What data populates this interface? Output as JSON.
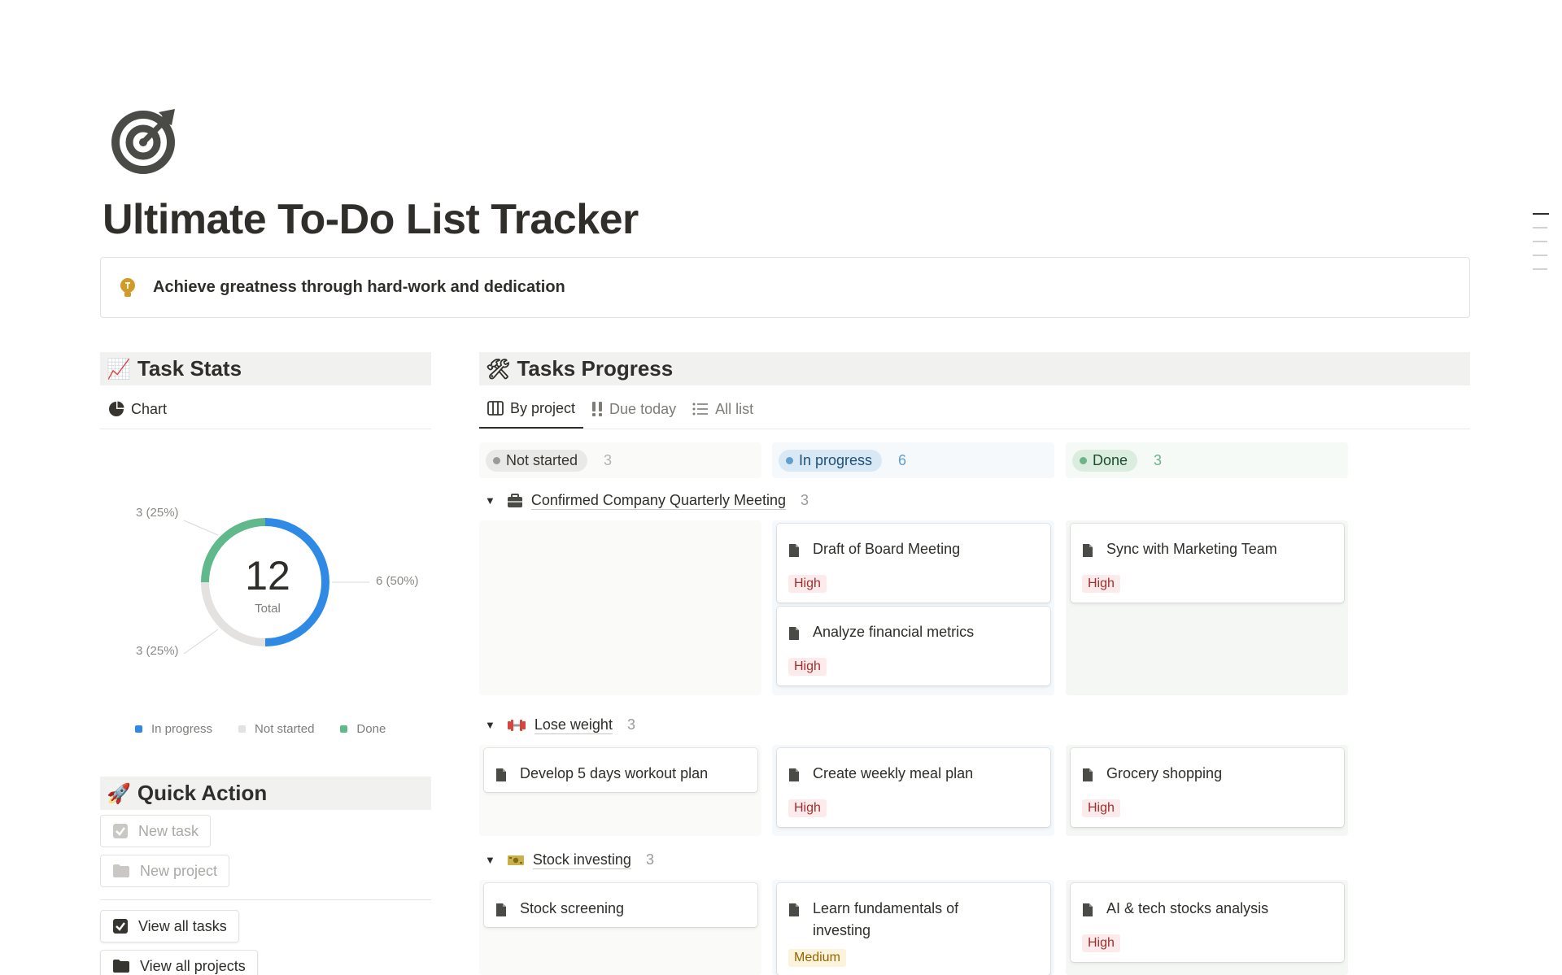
{
  "page": {
    "title": "Ultimate To-Do List Tracker",
    "icon": "target-icon",
    "callout": {
      "icon": "lightbulb-icon",
      "text": "Achieve greatness through hard-work and dedication"
    }
  },
  "task_stats": {
    "heading_emoji": "📈",
    "heading": "Task Stats",
    "view_tab": "Chart",
    "chart": {
      "total_value": "12",
      "total_label": "Total",
      "labels": {
        "in_progress": "6 (50%)",
        "done": "3 (25%)",
        "not_started": "3 (25%)"
      }
    },
    "legend": [
      "In progress",
      "Not started",
      "Done"
    ]
  },
  "chart_data": {
    "type": "pie",
    "variant": "donut",
    "categories": [
      "In progress",
      "Not started",
      "Done"
    ],
    "values": [
      6,
      3,
      3
    ],
    "percentages": [
      50,
      25,
      25
    ],
    "colors": [
      "#2f8ae6",
      "#e3e2e0",
      "#5fb98a"
    ],
    "center_text": "12",
    "center_subtext": "Total",
    "legend_position": "bottom"
  },
  "quick_action": {
    "heading_emoji": "🚀",
    "heading": "Quick Action",
    "buttons": [
      {
        "label": "New task",
        "icon": "checkbox-icon"
      },
      {
        "label": "New project",
        "icon": "folder-icon"
      },
      {
        "label": "View all tasks",
        "icon": "checkbox-icon"
      },
      {
        "label": "View all projects",
        "icon": "folder-icon"
      }
    ]
  },
  "tasks_progress": {
    "heading_emoji": "🛠",
    "heading": "Tasks Progress",
    "tabs": [
      {
        "label": "By project",
        "icon": "board-icon",
        "active": true
      },
      {
        "label": "Due today",
        "icon": "double-exclamation-icon",
        "active": false
      },
      {
        "label": "All list",
        "icon": "list-icon",
        "active": false
      }
    ],
    "columns": [
      {
        "label": "Not started",
        "count": "3",
        "color": "#9b9a97"
      },
      {
        "label": "In progress",
        "count": "6",
        "color": "#5e9fd0"
      },
      {
        "label": "Done",
        "count": "3",
        "color": "#6cb48a"
      }
    ],
    "groups": [
      {
        "name": "Confirmed Company Quarterly Meeting",
        "count": "3",
        "icon": "briefcase-icon",
        "cards": {
          "in_progress": [
            {
              "title": "Draft of Board Meeting",
              "priority": "High"
            },
            {
              "title": "Analyze financial metrics",
              "priority": "High"
            }
          ],
          "done": [
            {
              "title": "Sync with Marketing Team",
              "priority": "High"
            }
          ]
        }
      },
      {
        "name": "Lose weight",
        "count": "3",
        "icon": "dumbbell-icon",
        "cards": {
          "not_started": [
            {
              "title": "Develop 5 days workout plan"
            }
          ],
          "in_progress": [
            {
              "title": "Create weekly meal plan",
              "priority": "High"
            }
          ],
          "done": [
            {
              "title": "Grocery shopping",
              "priority": "High"
            }
          ]
        }
      },
      {
        "name": "Stock investing",
        "count": "3",
        "icon": "money-icon",
        "cards": {
          "not_started": [
            {
              "title": "Stock screening"
            }
          ],
          "in_progress": [
            {
              "title": "Learn fundamentals of investing",
              "priority": "Medium"
            }
          ],
          "done": [
            {
              "title": "AI & tech stocks analysis",
              "priority": "High"
            }
          ]
        }
      }
    ]
  }
}
